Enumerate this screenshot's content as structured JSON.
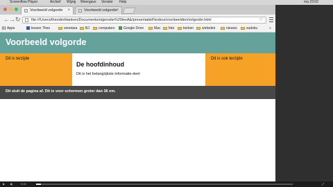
{
  "os_menubar": {
    "items": [
      "Screenflow Player",
      "Archief",
      "Wijzig",
      "Weergave",
      "Venster",
      "Help"
    ],
    "clock": "ma 23:02"
  },
  "browser": {
    "tabs": [
      {
        "label": "Voorbeeld volgorde",
        "active": true
      },
      {
        "label": "Voorbeeld volgorde",
        "active": false
      }
    ],
    "url": "file:///Users/theoderblanken/Documents/eigensite%20lesA&/presentatieFlexbox/voorbeelden/volgorde.html",
    "bookmarks": [
      "Apps",
      "lessen Theo",
      "venetara",
      "BJ",
      "computers",
      "Google Drive",
      "Mac",
      "foto",
      "kerken",
      "winkelen",
      "nieuws",
      "sudoku"
    ]
  },
  "page": {
    "header": "Voorbeeld volgorde",
    "aside_left": "Dit is terzijde",
    "main_title": "De hoofdinhoud",
    "main_text": "Dit is het belangrijkste informatie-deel",
    "aside_right": "Dit is ook terzijde",
    "footer": "Dit sluit de pagina af. Dit is voor schermen groter dan 36 em."
  },
  "player": {
    "time": "0:06",
    "progress_fraction": 0.02
  },
  "colors": {
    "header_bg": "#66a29c",
    "aside_bg": "#f5a227",
    "footer_bg": "#484848"
  }
}
